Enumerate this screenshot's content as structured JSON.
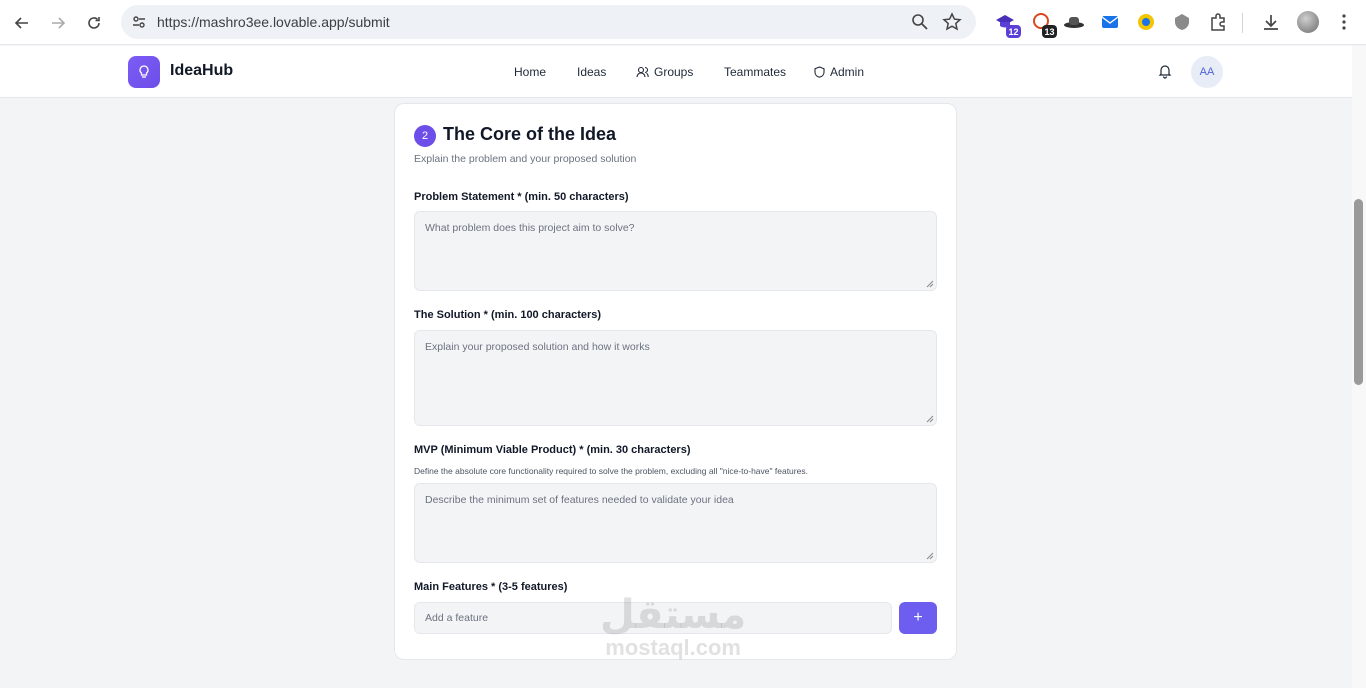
{
  "browser": {
    "url": "https://mashro3ee.lovable.app/submit",
    "extensions": [
      {
        "name": "graduation-cap-extension-icon",
        "badge": "12",
        "badge_color": "#5b3fd6"
      },
      {
        "name": "chat-extension-icon",
        "badge": "13",
        "badge_color": "#202124"
      },
      {
        "name": "hat-extension-icon"
      },
      {
        "name": "mail-extension-icon"
      },
      {
        "name": "circle-extension-icon"
      },
      {
        "name": "shield-extension-icon"
      }
    ]
  },
  "app": {
    "name": "IdeaHub",
    "accent": "#6d4ee8",
    "nav": [
      {
        "label": "Home"
      },
      {
        "label": "Ideas"
      },
      {
        "label": "Groups"
      },
      {
        "label": "Teammates"
      },
      {
        "label": "Admin"
      }
    ],
    "avatar_initials": "AA"
  },
  "section": {
    "step": "2",
    "title": "The Core of the Idea",
    "subtitle": "Explain the problem and your proposed solution"
  },
  "fields": {
    "problem": {
      "label": "Problem Statement * (min. 50 characters)",
      "placeholder": "What problem does this project aim to solve?",
      "value": ""
    },
    "solution": {
      "label": "The Solution * (min. 100 characters)",
      "placeholder": "Explain your proposed solution and how it works",
      "value": ""
    },
    "mvp": {
      "label": "MVP (Minimum Viable Product) * (min. 30 characters)",
      "hint": "Define the absolute core functionality required to solve the problem, excluding all \"nice-to-have\" features.",
      "placeholder": "Describe the minimum set of features needed to validate your idea",
      "value": ""
    },
    "features": {
      "label": "Main Features * (3-5 features)",
      "placeholder": "Add a feature",
      "add_label": "+"
    }
  },
  "watermark": {
    "arabic": "مستقل",
    "latin": "mostaql.com"
  }
}
